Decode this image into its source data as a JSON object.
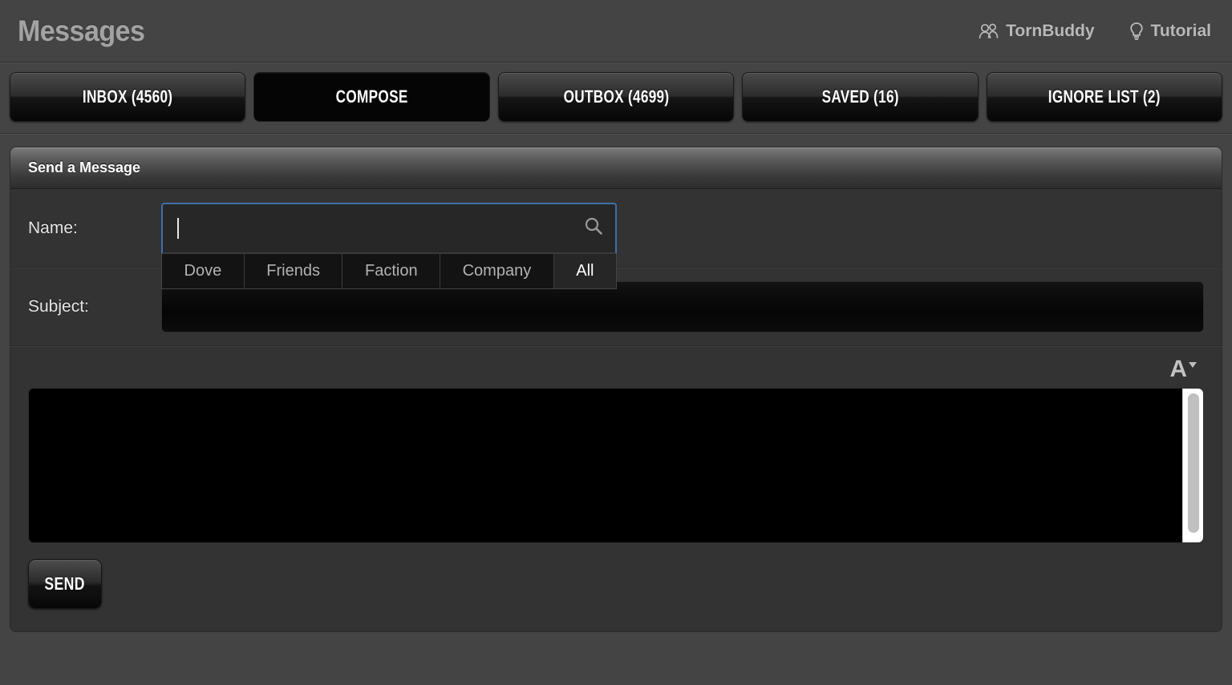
{
  "header": {
    "title": "Messages",
    "links": [
      {
        "label": "TornBuddy",
        "icon": "people-icon"
      },
      {
        "label": "Tutorial",
        "icon": "lightbulb-icon"
      }
    ]
  },
  "tabs": [
    {
      "label": "INBOX (4560)",
      "active": false
    },
    {
      "label": "COMPOSE",
      "active": true
    },
    {
      "label": "OUTBOX (4699)",
      "active": false
    },
    {
      "label": "SAVED (16)",
      "active": false
    },
    {
      "label": "IGNORE LIST (2)",
      "active": false
    }
  ],
  "panel": {
    "title": "Send a Message"
  },
  "form": {
    "name_label": "Name:",
    "name_value": "",
    "name_placeholder": "",
    "search_icon": "search-icon",
    "filter_tabs": [
      {
        "label": "Dove",
        "active": false
      },
      {
        "label": "Friends",
        "active": false
      },
      {
        "label": "Faction",
        "active": false
      },
      {
        "label": "Company",
        "active": false
      },
      {
        "label": "All",
        "active": true
      }
    ],
    "subject_label": "Subject:",
    "subject_value": "",
    "subject_placeholder": ""
  },
  "editor": {
    "font_glyph": "A",
    "font_tool_name": "font-size-dropdown",
    "body_value": "",
    "scroll_position": "top"
  },
  "actions": {
    "send_label": "SEND"
  },
  "colors": {
    "page_background": "#444444",
    "panel_background": "#333333",
    "tab_active_background": "#050505",
    "focus_border": "#3f6fa8",
    "editor_background": "#000000",
    "scrollbar_track": "#ffffff",
    "scrollbar_thumb": "#c0c0c0",
    "title_text": "#a3a3a3"
  }
}
